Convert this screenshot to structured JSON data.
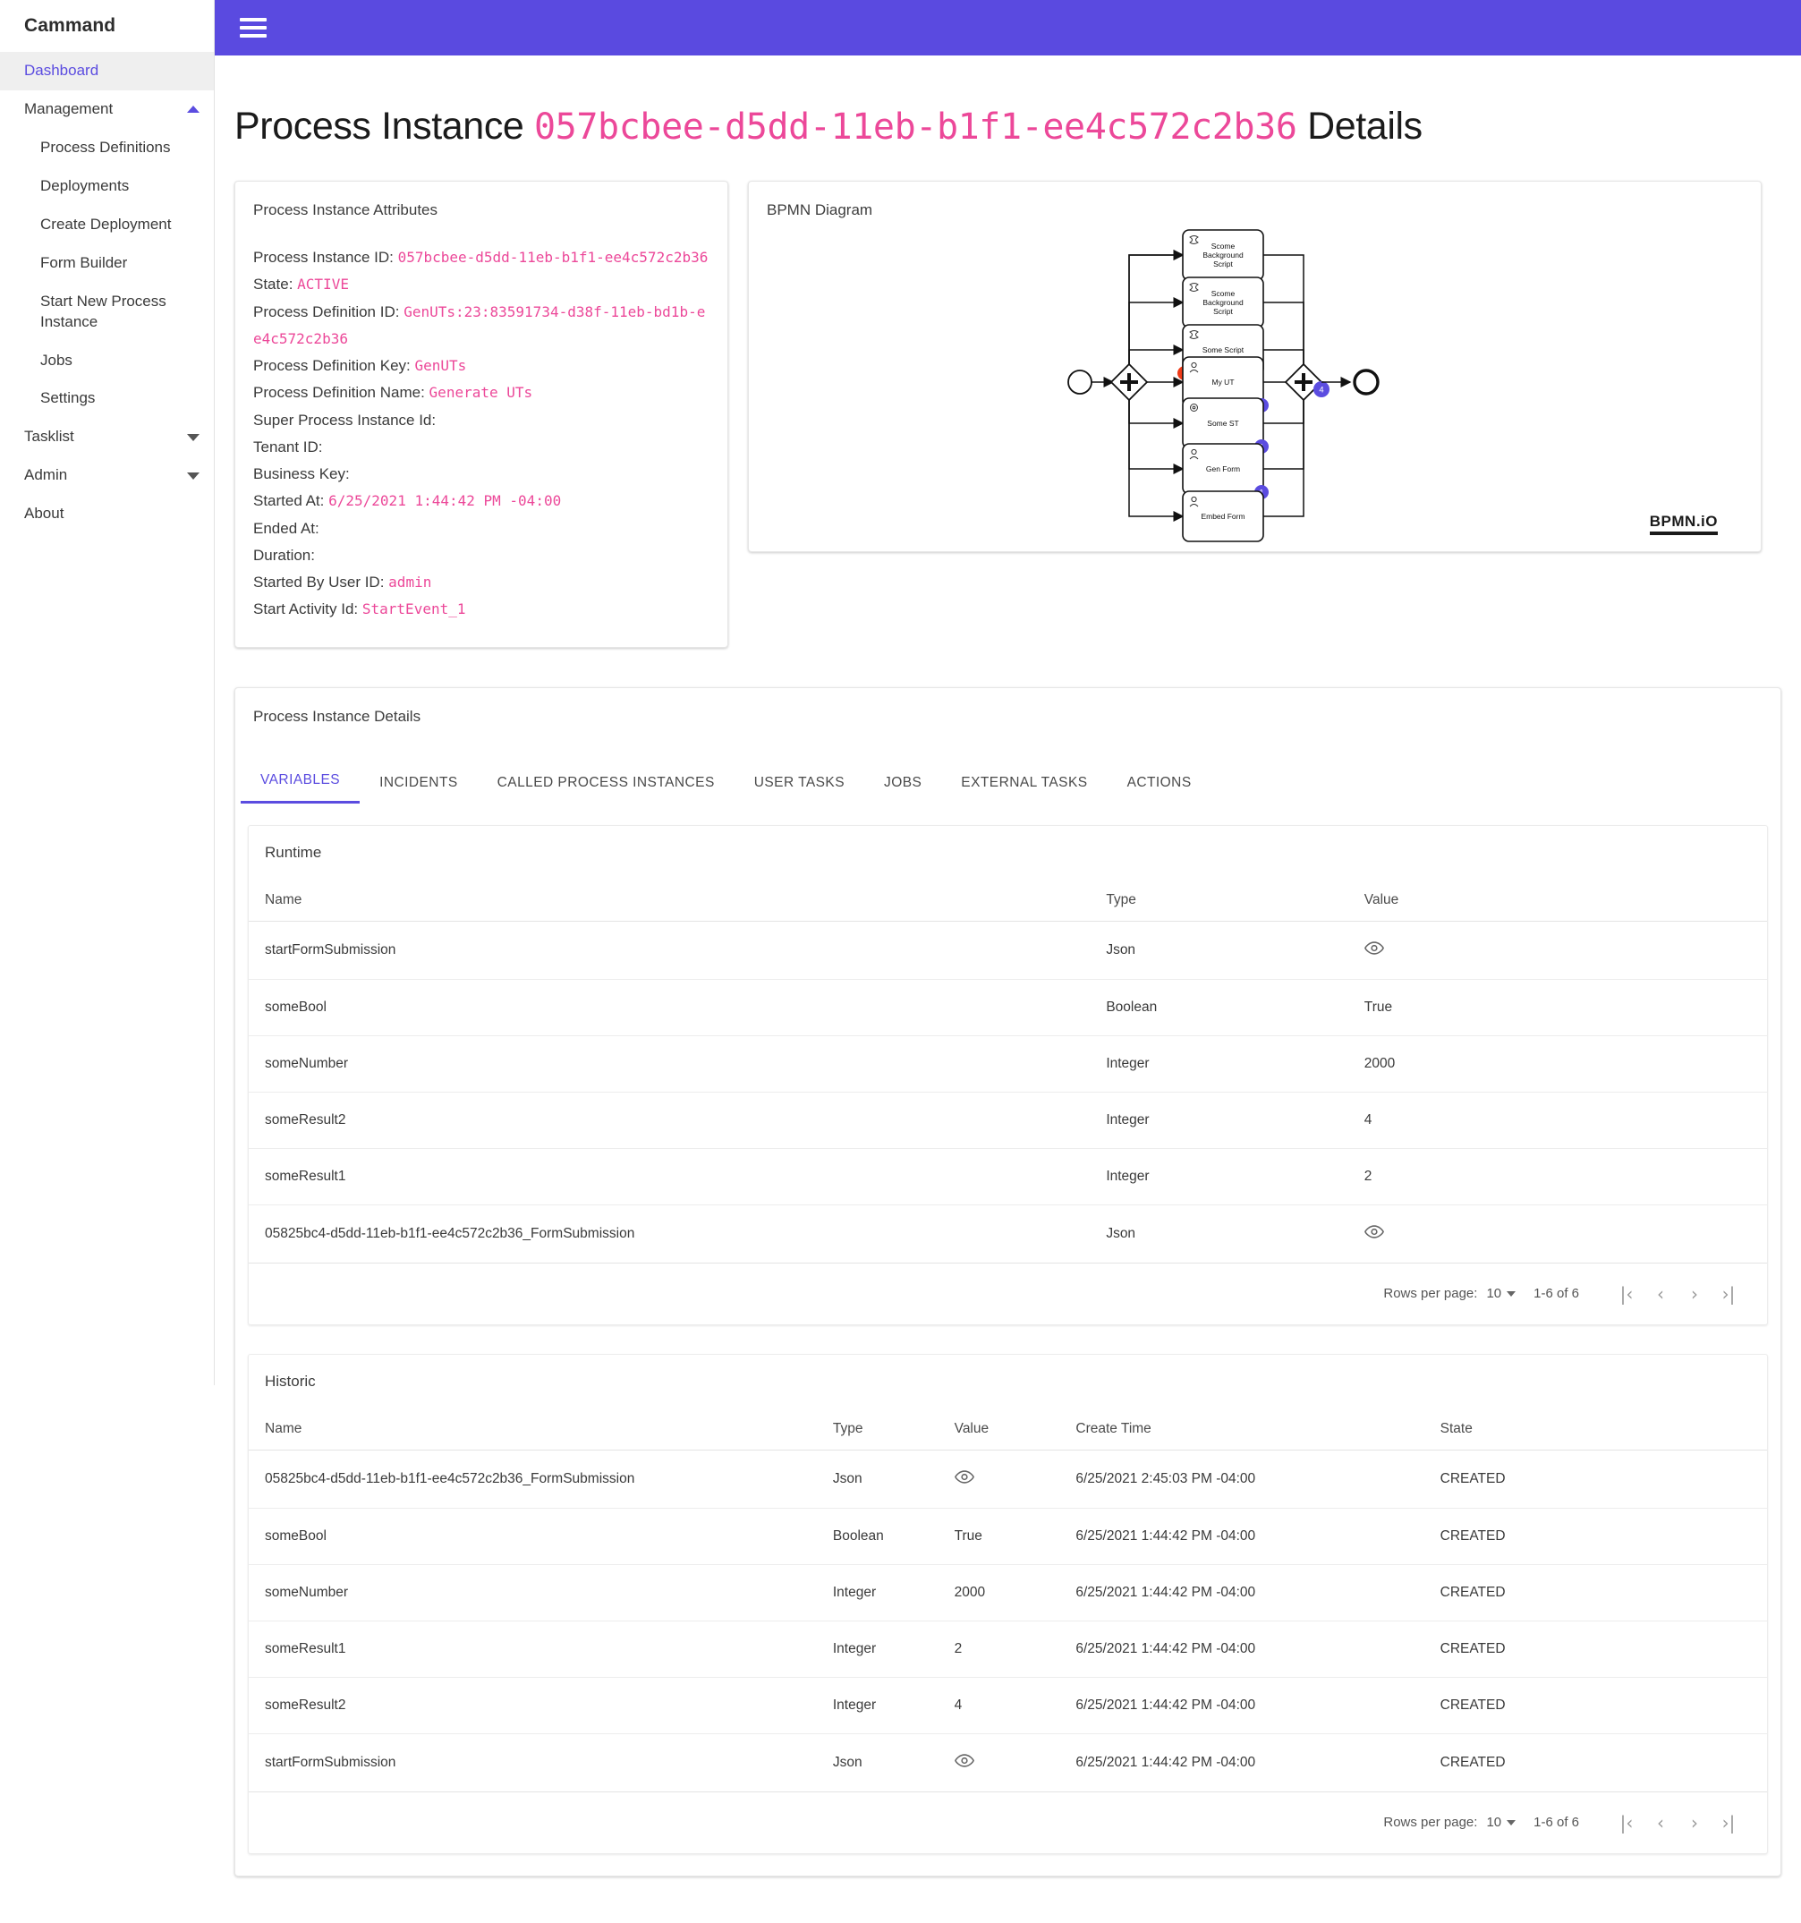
{
  "app": {
    "brand": "Cammand",
    "header_color": "#5a4ae0",
    "accent_color": "#5b4ce0",
    "code_color": "#ec4899"
  },
  "sidebar": {
    "dashboard": "Dashboard",
    "groups": [
      {
        "label": "Management",
        "expanded": true,
        "items": [
          "Process Definitions",
          "Deployments",
          "Create Deployment",
          "Form Builder",
          "Start New Process Instance",
          "Jobs",
          "Settings"
        ]
      },
      {
        "label": "Tasklist",
        "expanded": false,
        "items": []
      },
      {
        "label": "Admin",
        "expanded": false,
        "items": []
      }
    ],
    "about": "About"
  },
  "page": {
    "title_prefix": "Process Instance",
    "title_id": "057bcbee-d5dd-11eb-b1f1-ee4c572c2b36",
    "title_suffix": "Details"
  },
  "attributes": {
    "card_title": "Process Instance Attributes",
    "rows": [
      {
        "label": "Process Instance ID:",
        "value": "057bcbee-d5dd-11eb-b1f1-ee4c572c2b36"
      },
      {
        "label": "State:",
        "value": "ACTIVE"
      },
      {
        "label": "Process Definition ID:",
        "value": "GenUTs:23:83591734-d38f-11eb-bd1b-ee4c572c2b36"
      },
      {
        "label": "Process Definition Key:",
        "value": "GenUTs"
      },
      {
        "label": "Process Definition Name:",
        "value": "Generate UTs"
      },
      {
        "label": "Super Process Instance Id:",
        "value": ""
      },
      {
        "label": "Tenant ID:",
        "value": ""
      },
      {
        "label": "Business Key:",
        "value": ""
      },
      {
        "label": "Started At:",
        "value": "6/25/2021 1:44:42 PM -04:00"
      },
      {
        "label": "Ended At:",
        "value": ""
      },
      {
        "label": "Duration:",
        "value": ""
      },
      {
        "label": "Started By User ID:",
        "value": "admin"
      },
      {
        "label": "Start Activity Id:",
        "value": "StartEvent_1"
      }
    ]
  },
  "bpmn": {
    "card_title": "BPMN Diagram",
    "logo": "BPMN.iO",
    "tasks": [
      {
        "label": "Scome Background Script",
        "type": "script",
        "badge": "",
        "badge_color": ""
      },
      {
        "label": "Scome Background Script",
        "type": "script",
        "badge": "",
        "badge_color": ""
      },
      {
        "label": "Some Script",
        "type": "script",
        "badge": "1",
        "badge_color": "#f03a17"
      },
      {
        "label": "My UT",
        "type": "user",
        "badge": "1",
        "badge_color": "#5b4ce0"
      },
      {
        "label": "Some ST",
        "type": "service",
        "badge": "1",
        "badge_color": "#5b4ce0"
      },
      {
        "label": "Gen Form",
        "type": "user",
        "badge": "1",
        "badge_color": "#5b4ce0"
      },
      {
        "label": "Embed Form",
        "type": "user",
        "badge": "",
        "badge_color": ""
      }
    ],
    "join_gateway_badge": "4"
  },
  "details": {
    "card_title": "Process Instance Details",
    "tabs": [
      {
        "label": "VARIABLES",
        "active": true
      },
      {
        "label": "INCIDENTS",
        "active": false
      },
      {
        "label": "CALLED PROCESS INSTANCES",
        "active": false
      },
      {
        "label": "USER TASKS",
        "active": false
      },
      {
        "label": "JOBS",
        "active": false
      },
      {
        "label": "EXTERNAL TASKS",
        "active": false
      },
      {
        "label": "ACTIONS",
        "active": false
      }
    ]
  },
  "runtime": {
    "title": "Runtime",
    "columns": [
      "Name",
      "Type",
      "Value"
    ],
    "rows": [
      {
        "name": "startFormSubmission",
        "type": "Json",
        "value": "",
        "value_icon": "eye-icon"
      },
      {
        "name": "someBool",
        "type": "Boolean",
        "value": "True",
        "value_icon": ""
      },
      {
        "name": "someNumber",
        "type": "Integer",
        "value": "2000",
        "value_icon": ""
      },
      {
        "name": "someResult2",
        "type": "Integer",
        "value": "4",
        "value_icon": ""
      },
      {
        "name": "someResult1",
        "type": "Integer",
        "value": "2",
        "value_icon": ""
      },
      {
        "name": "05825bc4-d5dd-11eb-b1f1-ee4c572c2b36_FormSubmission",
        "type": "Json",
        "value": "",
        "value_icon": "eye-icon"
      }
    ],
    "pager": {
      "rows_per_page_label": "Rows per page:",
      "rows_per_page": "10",
      "range": "1-6 of 6",
      "first": "|‹",
      "prev": "‹",
      "next": "›",
      "last": "›|"
    }
  },
  "historic": {
    "title": "Historic",
    "columns": [
      "Name",
      "Type",
      "Value",
      "Create Time",
      "State"
    ],
    "rows": [
      {
        "name": "05825bc4-d5dd-11eb-b1f1-ee4c572c2b36_FormSubmission",
        "type": "Json",
        "value": "",
        "value_icon": "eye-icon",
        "create_time": "6/25/2021 2:45:03 PM -04:00",
        "state": "CREATED"
      },
      {
        "name": "someBool",
        "type": "Boolean",
        "value": "True",
        "value_icon": "",
        "create_time": "6/25/2021 1:44:42 PM -04:00",
        "state": "CREATED"
      },
      {
        "name": "someNumber",
        "type": "Integer",
        "value": "2000",
        "value_icon": "",
        "create_time": "6/25/2021 1:44:42 PM -04:00",
        "state": "CREATED"
      },
      {
        "name": "someResult1",
        "type": "Integer",
        "value": "2",
        "value_icon": "",
        "create_time": "6/25/2021 1:44:42 PM -04:00",
        "state": "CREATED"
      },
      {
        "name": "someResult2",
        "type": "Integer",
        "value": "4",
        "value_icon": "",
        "create_time": "6/25/2021 1:44:42 PM -04:00",
        "state": "CREATED"
      },
      {
        "name": "startFormSubmission",
        "type": "Json",
        "value": "",
        "value_icon": "eye-icon",
        "create_time": "6/25/2021 1:44:42 PM -04:00",
        "state": "CREATED"
      }
    ],
    "pager": {
      "rows_per_page_label": "Rows per page:",
      "rows_per_page": "10",
      "range": "1-6 of 6",
      "first": "|‹",
      "prev": "‹",
      "next": "›",
      "last": "›|"
    }
  }
}
